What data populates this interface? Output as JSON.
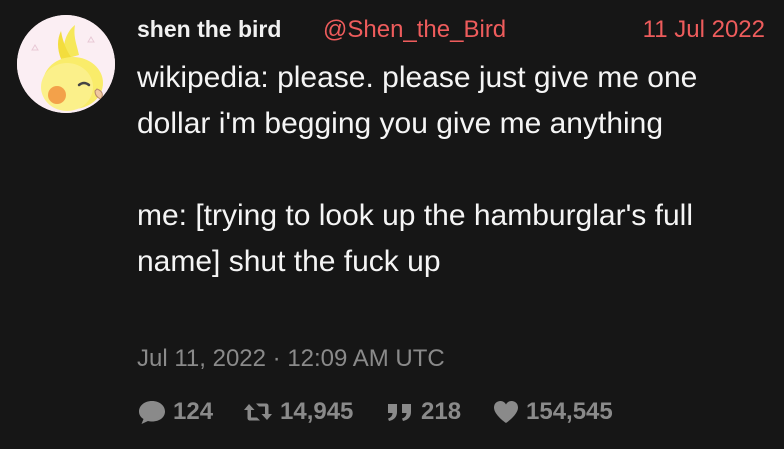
{
  "tweet": {
    "display_name": "shen the bird",
    "username": "@Shen_the_Bird",
    "date": "11 Jul 2022",
    "body": "wikipedia: please. please just give me one dollar i'm begging you give me anything\n\nme: [trying to look up the hamburglar's full name] shut the fuck up",
    "timestamp": "Jul 11, 2022 · 12:09 AM UTC"
  },
  "stats": {
    "comments": "124",
    "retweets": "14,945",
    "quotes": "218",
    "likes": "154,545"
  },
  "icons": {
    "avatar": "cockatiel-avatar",
    "comments": "speech-bubble-icon",
    "retweets": "retweet-icon",
    "quotes": "quote-icon",
    "likes": "heart-icon"
  },
  "colors": {
    "background": "#161616",
    "accent": "#ee5c5c",
    "text": "#f1f1f1",
    "muted": "#8a8a8a"
  }
}
